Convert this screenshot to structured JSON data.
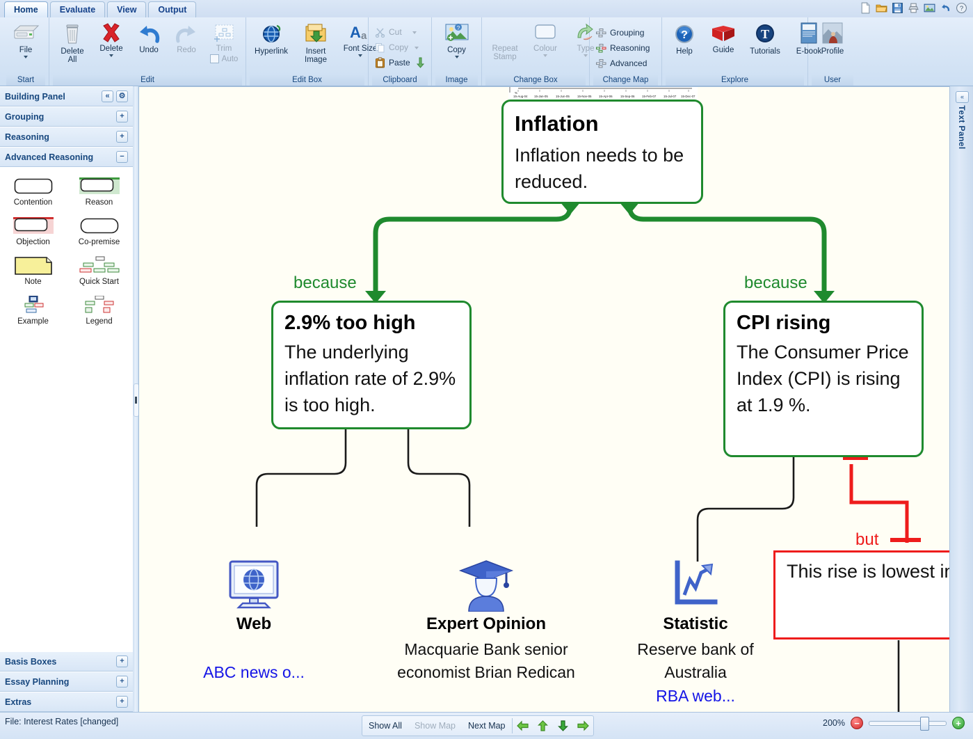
{
  "window": {
    "tabs": [
      {
        "label": "Home",
        "active": true
      },
      {
        "label": "Evaluate",
        "active": false
      },
      {
        "label": "View",
        "active": false
      },
      {
        "label": "Output",
        "active": false
      }
    ],
    "quick_access": [
      "new-document-icon",
      "open-folder-icon",
      "save-disk-icon",
      "print-icon",
      "image-icon",
      "undo-icon",
      "help-icon"
    ]
  },
  "ribbon": {
    "groups": [
      {
        "title": "Start",
        "buttons": [
          {
            "label": "File",
            "icon": "file-drawer-icon",
            "caret": true,
            "disabled": false
          }
        ]
      },
      {
        "title": "Edit",
        "buttons": [
          {
            "label": "Delete All",
            "icon": "trash-icon",
            "caret": false,
            "disabled": false
          },
          {
            "label": "Delete",
            "icon": "red-x-icon",
            "caret": true,
            "disabled": false
          },
          {
            "label": "Undo",
            "icon": "undo-arrow-icon",
            "caret": false,
            "disabled": false
          },
          {
            "label": "Redo",
            "icon": "redo-arrow-icon",
            "caret": false,
            "disabled": true
          },
          {
            "label": "Trim",
            "icon": "trim-icon",
            "caret": false,
            "disabled": true
          }
        ],
        "checkbox": {
          "label": "Auto",
          "checked": false
        }
      },
      {
        "title": "Edit Box",
        "buttons": [
          {
            "label": "Hyperlink",
            "icon": "globe-link-icon",
            "caret": false,
            "disabled": false
          },
          {
            "label": "Insert Image",
            "icon": "insert-image-icon",
            "caret": false,
            "disabled": false
          },
          {
            "label": "Font Size",
            "icon": "font-size-icon",
            "caret": true,
            "disabled": false
          }
        ]
      },
      {
        "title": "Clipboard",
        "small_items": [
          {
            "label": "Cut",
            "icon": "scissors-icon",
            "caret": true,
            "disabled": true
          },
          {
            "label": "Copy",
            "icon": "copy-pages-icon",
            "caret": true,
            "disabled": true
          },
          {
            "label": "Paste",
            "icon": "clipboard-icon",
            "caret": false,
            "arrow": true,
            "disabled": false
          }
        ]
      },
      {
        "title": "Image",
        "buttons": [
          {
            "label": "Copy",
            "icon": "picture-copy-icon",
            "caret": true,
            "disabled": false
          }
        ]
      },
      {
        "title": "Change Box",
        "buttons": [
          {
            "label": "Repeat Stamp",
            "icon": "stamp-icon",
            "caret": false,
            "disabled": true
          },
          {
            "label": "Colour",
            "icon": "colour-box-icon",
            "caret": true,
            "disabled": true
          },
          {
            "label": "Type",
            "icon": "type-swap-icon",
            "caret": true,
            "disabled": true
          }
        ]
      },
      {
        "title": "Change Map",
        "small_items": [
          {
            "label": "Grouping",
            "icon": "grouping-map-icon",
            "disabled": false
          },
          {
            "label": "Reasoning",
            "icon": "reasoning-map-icon",
            "disabled": false
          },
          {
            "label": "Advanced",
            "icon": "advanced-map-icon",
            "disabled": false
          }
        ]
      },
      {
        "title": "Explore",
        "buttons": [
          {
            "label": "Help",
            "icon": "question-ball-icon",
            "caret": false,
            "disabled": false
          },
          {
            "label": "Guide",
            "icon": "open-book-icon",
            "caret": false,
            "disabled": false
          },
          {
            "label": "Tutorials",
            "icon": "tutorials-t-icon",
            "caret": false,
            "disabled": false
          },
          {
            "label": "E-book",
            "icon": "ebook-icon",
            "caret": false,
            "disabled": false
          }
        ]
      },
      {
        "title": "User",
        "buttons": [
          {
            "label": "Profile",
            "icon": "profile-photo-icon",
            "caret": false,
            "disabled": false
          }
        ]
      }
    ]
  },
  "building_panel": {
    "title": "Building Panel",
    "collapse_label": "«",
    "settings_label": "⚙",
    "sections": [
      {
        "label": "Grouping",
        "state": "+"
      },
      {
        "label": "Reasoning",
        "state": "+"
      },
      {
        "label": "Advanced Reasoning",
        "state": "−"
      }
    ],
    "palette": [
      [
        {
          "label": "Contention",
          "icon": "contention-box-icon"
        },
        {
          "label": "Reason",
          "icon": "reason-box-icon"
        }
      ],
      [
        {
          "label": "Objection",
          "icon": "objection-box-icon"
        },
        {
          "label": "Co-premise",
          "icon": "copremise-box-icon"
        }
      ],
      [
        {
          "label": "Note",
          "icon": "note-icon"
        },
        {
          "label": "Quick Start",
          "icon": "quick-start-icon"
        }
      ],
      [
        {
          "label": "Example",
          "icon": "example-icon"
        },
        {
          "label": "Legend",
          "icon": "legend-icon"
        }
      ]
    ],
    "bottom_sections": [
      {
        "label": "Basis Boxes",
        "state": "+"
      },
      {
        "label": "Essay Planning",
        "state": "+"
      },
      {
        "label": "Extras",
        "state": "+"
      }
    ]
  },
  "text_panel": {
    "label": "Text Panel",
    "collapse_label": "«"
  },
  "map": {
    "nodes": [
      {
        "id": "inflation",
        "type": "contention",
        "title": "Inflation",
        "body": "Inflation needs to be reduced.",
        "color": "#1f8a2e"
      },
      {
        "id": "too-high",
        "type": "reason",
        "title": "2.9% too high",
        "body": "The underlying inflation rate of 2.9% is too high.",
        "color": "#1f8a2e"
      },
      {
        "id": "cpi-rising",
        "type": "reason",
        "title": "CPI rising",
        "body": "The Consumer Price Index (CPI) is rising at 1.9 %.",
        "color": "#1f8a2e"
      },
      {
        "id": "objection",
        "type": "objection",
        "title": "",
        "body": "This rise is lowest in nearly eight years.",
        "color": "#ee1c1c"
      }
    ],
    "connector_labels": [
      {
        "id": "because-left",
        "text": "because",
        "color": "#1f8a2e"
      },
      {
        "id": "because-right",
        "text": "because",
        "color": "#1f8a2e"
      },
      {
        "id": "but",
        "text": "but",
        "color": "#ee1c1c"
      }
    ],
    "sources": [
      {
        "id": "web",
        "icon": "web-monitor-icon",
        "name": "Web",
        "desc": "",
        "link": "ABC news o..."
      },
      {
        "id": "expert",
        "icon": "graduate-person-icon",
        "name": "Expert Opinion",
        "desc": "Macquarie Bank senior economist Brian Redican",
        "link": ""
      },
      {
        "id": "statistic",
        "icon": "statistic-chart-icon",
        "name": "Statistic",
        "desc": "Reserve bank of Australia",
        "link": "RBA web..."
      }
    ],
    "chart_strip_labels": [
      "15-Aug-04",
      "15-Jan-05",
      "15-Jun-05",
      "15-Nov-05",
      "15-Apr-06",
      "15-Sep-06",
      "15-Feb-07",
      "15-Jul-07",
      "15-Dec-07"
    ]
  },
  "status_bar": {
    "file_label": "File: Interest Rates [changed]",
    "nav_buttons": [
      {
        "label": "Show All",
        "disabled": false
      },
      {
        "label": "Show Map",
        "disabled": true
      },
      {
        "label": "Next Map",
        "disabled": false
      }
    ],
    "arrows": [
      "left-arrow-icon",
      "up-arrow-icon",
      "down-arrow-icon",
      "right-arrow-icon"
    ],
    "zoom_level": "200%",
    "zoom_out_label": "−",
    "zoom_in_label": "+"
  },
  "colors": {
    "reason_green": "#1f8a2e",
    "objection_red": "#ee1c1c",
    "link_blue": "#1414e6",
    "canvas_bg": "#fffef5",
    "chrome_blue": "#17477e"
  }
}
